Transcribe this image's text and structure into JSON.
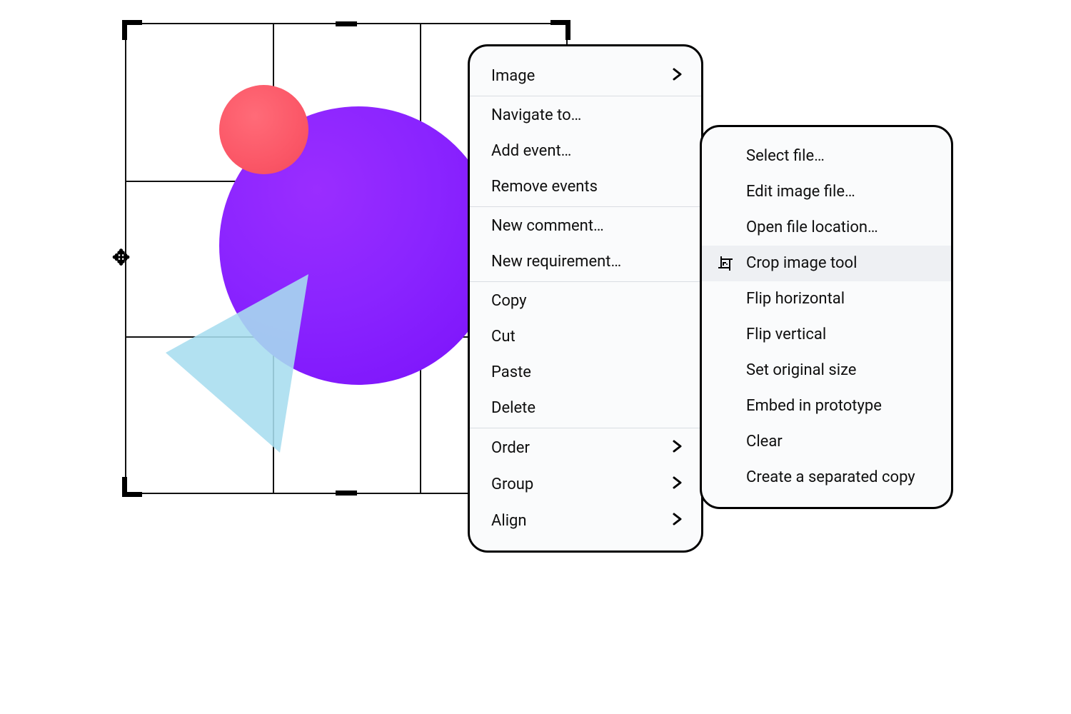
{
  "canvas": {
    "shapes": {
      "purple_circle": "purple-circle",
      "pink_circle": "pink-circle",
      "blue_triangle": "blue-triangle"
    }
  },
  "context_menu": {
    "groups": [
      [
        {
          "key": "image",
          "label": "Image",
          "submenu": true
        }
      ],
      [
        {
          "key": "navigate",
          "label": "Navigate to…"
        },
        {
          "key": "add_event",
          "label": "Add event…"
        },
        {
          "key": "remove_events",
          "label": "Remove events"
        }
      ],
      [
        {
          "key": "new_comment",
          "label": "New comment…"
        },
        {
          "key": "new_requirement",
          "label": "New requirement…"
        }
      ],
      [
        {
          "key": "copy",
          "label": "Copy"
        },
        {
          "key": "cut",
          "label": "Cut"
        },
        {
          "key": "paste",
          "label": "Paste"
        },
        {
          "key": "delete",
          "label": "Delete"
        }
      ],
      [
        {
          "key": "order",
          "label": "Order",
          "submenu": true
        },
        {
          "key": "group",
          "label": "Group",
          "submenu": true
        },
        {
          "key": "align",
          "label": "Align",
          "submenu": true
        }
      ]
    ]
  },
  "image_submenu": {
    "items": [
      {
        "key": "select_file",
        "label": "Select file…"
      },
      {
        "key": "edit_image_file",
        "label": "Edit image file…"
      },
      {
        "key": "open_file_location",
        "label": "Open file location…"
      },
      {
        "key": "crop_image_tool",
        "label": "Crop image tool",
        "icon": "crop-image-icon",
        "highlighted": true
      },
      {
        "key": "flip_horizontal",
        "label": "Flip horizontal"
      },
      {
        "key": "flip_vertical",
        "label": "Flip vertical"
      },
      {
        "key": "set_original_size",
        "label": "Set original size"
      },
      {
        "key": "embed_in_prototype",
        "label": "Embed in prototype"
      },
      {
        "key": "clear",
        "label": "Clear"
      },
      {
        "key": "create_separated_copy",
        "label": "Create a separated copy"
      }
    ]
  }
}
